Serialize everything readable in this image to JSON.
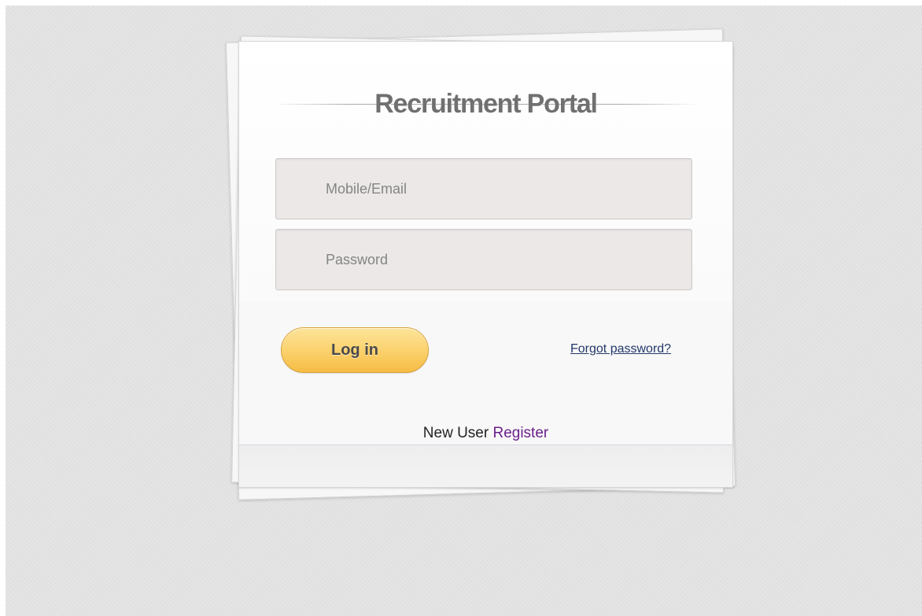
{
  "login": {
    "title": "Recruitment Portal",
    "email_placeholder": "Mobile/Email",
    "password_placeholder": "Password",
    "login_label": "Log in",
    "forgot_label": "Forgot password?",
    "new_user_text": "New User",
    "register_label": "Register"
  },
  "colors": {
    "login_button": "#fbd26f",
    "register_link": "#6b1f8a",
    "forgot_link": "#23386a"
  }
}
